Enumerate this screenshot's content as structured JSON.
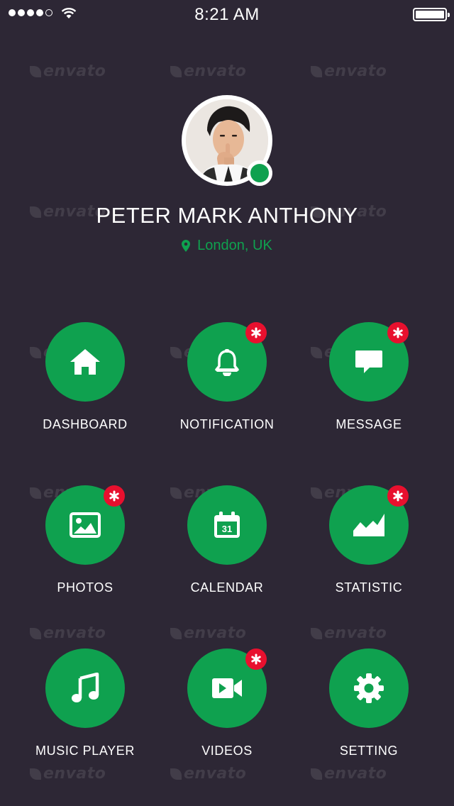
{
  "status_bar": {
    "time": "8:21 AM",
    "signal_bars": 4,
    "signal_max": 5,
    "battery_icon": "battery-full-icon",
    "wifi_icon": "wifi-icon"
  },
  "profile": {
    "name": "PETER MARK ANTHONY",
    "location": "London, UK",
    "online": true,
    "location_icon": "map-pin-icon"
  },
  "watermark": "envato",
  "colors": {
    "background": "#2d2735",
    "accent": "#0fa14f",
    "badge": "#e8102e",
    "text": "#ffffff"
  },
  "menu": [
    {
      "label": "DASHBOARD",
      "icon": "home-icon",
      "badge": false
    },
    {
      "label": "NOTIFICATION",
      "icon": "bell-icon",
      "badge": true
    },
    {
      "label": "MESSAGE",
      "icon": "chat-bubble-icon",
      "badge": true
    },
    {
      "label": "PHOTOS",
      "icon": "image-icon",
      "badge": true
    },
    {
      "label": "CALENDAR",
      "icon": "calendar-icon",
      "icon_text": "31",
      "badge": false
    },
    {
      "label": "STATISTIC",
      "icon": "area-chart-icon",
      "badge": true
    },
    {
      "label": "MUSIC PLAYER",
      "icon": "music-note-icon",
      "badge": false
    },
    {
      "label": "VIDEOS",
      "icon": "video-camera-icon",
      "badge": true
    },
    {
      "label": "SETTING",
      "icon": "gear-icon",
      "badge": false
    }
  ]
}
